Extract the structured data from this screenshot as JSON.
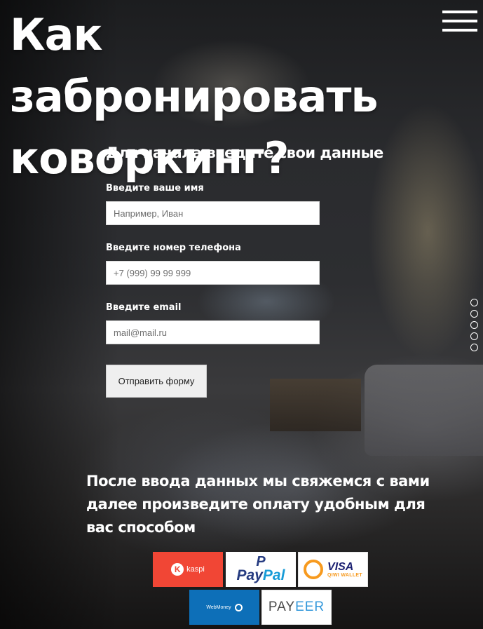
{
  "header": {
    "title": "Как забронировать коворкинг?",
    "menu_icon": "hamburger-menu-icon"
  },
  "form": {
    "heading": "Для начала введите свои данные",
    "name_label": "Введите ваше имя",
    "name_placeholder": "Например, Иван",
    "phone_label": "Введите номер телефона",
    "phone_placeholder": "+7 (999) 99 99 999",
    "email_label": "Введите email",
    "email_placeholder": "mail@mail.ru",
    "submit_label": "Отправить форму"
  },
  "slider": {
    "dot_count": 5
  },
  "after_submit": {
    "text": "После ввода данных мы свяжемся с вами далее произведите оплату удобным для вас способом"
  },
  "payment_methods": {
    "kaspi": {
      "mark": "K",
      "label": "kaspi",
      "color": "#f14635"
    },
    "paypal": {
      "mark": "P",
      "label_a": "Pay",
      "label_b": "Pal"
    },
    "qiwi": {
      "visa": "VISA",
      "wallet": "QIWI WALLET"
    },
    "webmoney": {
      "label": "WebMoney",
      "color": "#0d6fb8"
    },
    "payeer": {
      "label_a": "PAY",
      "label_b": "EER"
    }
  }
}
